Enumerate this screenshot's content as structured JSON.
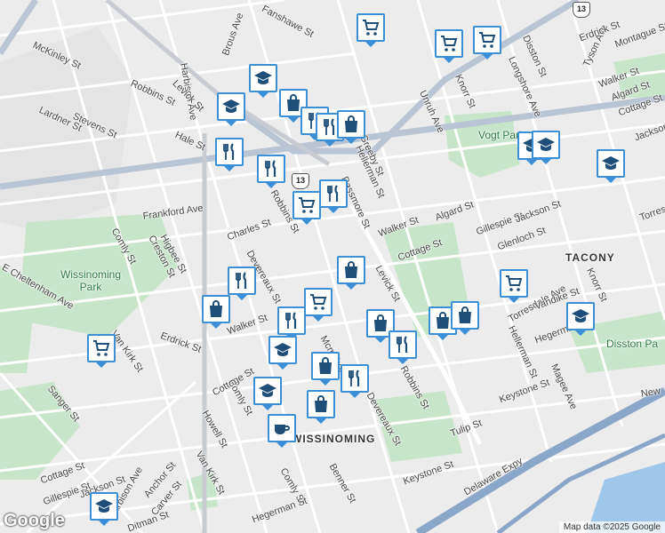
{
  "map": {
    "attribution": "Map data ©2025 Google",
    "logo_text": "Google",
    "neighborhoods": [
      {
        "id": "tacony",
        "text": "TACONY"
      },
      {
        "id": "wissinoming",
        "text": "WISSINOMING"
      }
    ],
    "parks": [
      {
        "id": "wissinoming-park",
        "text": "Wissinoming\nPark"
      },
      {
        "id": "vogt-park",
        "text": "Vogt Park"
      },
      {
        "id": "disston-park",
        "text": "Disston Pa"
      }
    ],
    "route_shield": "13",
    "streets": [
      "Fanshawe St",
      "Brous Ave",
      "Harbison Ave",
      "McKinley St",
      "Robbins St",
      "Levick St",
      "Stevens St",
      "Lardner St",
      "Hale St",
      "Frankford Ave",
      "Comly St",
      "Higbee St",
      "Creston St",
      "Charles St",
      "Devereaux St",
      "E Cheltenham Ave",
      "Erdrick St",
      "Van Kirk St",
      "Sanger St",
      "Cottage St",
      "Walker St",
      "Howell St",
      "Gillespie St",
      "Jackson St",
      "Anchor St",
      "Carver St",
      "Ditman St",
      "Benner St",
      "Hegerman St",
      "Keystone St",
      "Tulip St",
      "Delaware Expy",
      "Torresdale Ave",
      "Vandike St",
      "Magee Ave",
      "Knorr St",
      "Unruh Ave",
      "Longshore Ave",
      "Disston St",
      "Tyson Ave",
      "Montague St",
      "Algard St",
      "Greeby St",
      "Hellerman St",
      "Passmore St",
      "Glenloch St",
      "Mcmahon St",
      "Walker St",
      "Cottage St",
      "Erdrick St",
      "Gillespie St",
      "Jackson St",
      "Ja",
      "Torres",
      "New"
    ],
    "markers": [
      {
        "id": "m1",
        "type": "shopping-cart"
      },
      {
        "id": "m2",
        "type": "shopping-cart"
      },
      {
        "id": "m3",
        "type": "shopping-cart"
      },
      {
        "id": "m4",
        "type": "school"
      },
      {
        "id": "m5",
        "type": "school"
      },
      {
        "id": "m6",
        "type": "shopping-bag"
      },
      {
        "id": "m7",
        "type": "restaurant"
      },
      {
        "id": "m8",
        "type": "restaurant"
      },
      {
        "id": "m9",
        "type": "shopping-bag"
      },
      {
        "id": "m10",
        "type": "restaurant"
      },
      {
        "id": "m11",
        "type": "restaurant"
      },
      {
        "id": "m12",
        "type": "shopping-cart"
      },
      {
        "id": "m13",
        "type": "restaurant"
      },
      {
        "id": "m14",
        "type": "school"
      },
      {
        "id": "m15",
        "type": "school"
      },
      {
        "id": "m16",
        "type": "school"
      },
      {
        "id": "m17",
        "type": "shopping-bag"
      },
      {
        "id": "m18",
        "type": "restaurant"
      },
      {
        "id": "m19",
        "type": "shopping-bag"
      },
      {
        "id": "m20",
        "type": "shopping-cart"
      },
      {
        "id": "m21",
        "type": "restaurant"
      },
      {
        "id": "m22",
        "type": "shopping-bag"
      },
      {
        "id": "m23",
        "type": "restaurant"
      },
      {
        "id": "m24",
        "type": "shopping-bag"
      },
      {
        "id": "m25",
        "type": "shopping-bag"
      },
      {
        "id": "m26",
        "type": "shopping-cart"
      },
      {
        "id": "m27",
        "type": "school"
      },
      {
        "id": "m28",
        "type": "school"
      },
      {
        "id": "m29",
        "type": "shopping-bag"
      },
      {
        "id": "m30",
        "type": "restaurant"
      },
      {
        "id": "m31",
        "type": "shopping-cart"
      },
      {
        "id": "m32",
        "type": "school"
      },
      {
        "id": "m33",
        "type": "shopping-bag"
      },
      {
        "id": "m34",
        "type": "cafe"
      },
      {
        "id": "m35",
        "type": "school"
      },
      {
        "id": "m36",
        "type": "shopping-bag"
      },
      {
        "id": "m37",
        "type": "shopping-cart"
      }
    ]
  }
}
